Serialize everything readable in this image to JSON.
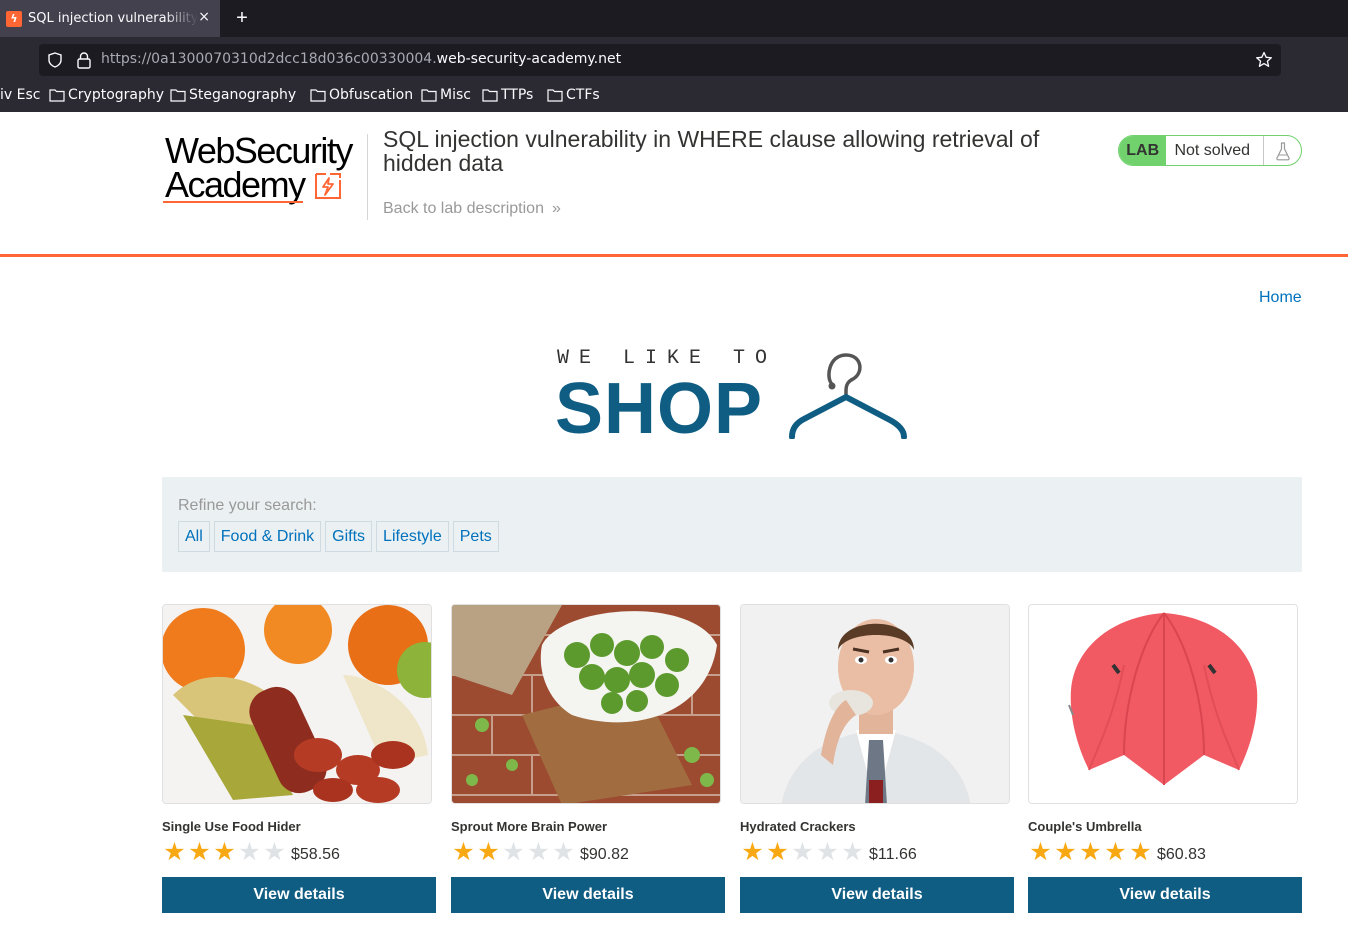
{
  "browser": {
    "tab_title": "SQL injection vulnerability",
    "tab_close": "×",
    "new_tab": "+",
    "url_prefix": "https://0a1300070310d2dcc18d036c00330004.",
    "url_domain": "web-security-academy.net",
    "bookmarks": [
      "iv Esc",
      "Cryptography",
      "Steganography",
      "Obfuscation",
      "Misc",
      "TTPs",
      "CTFs"
    ]
  },
  "lab": {
    "logo_line1": "WebSecurity",
    "logo_line2": "Academy",
    "title": "SQL injection vulnerability in WHERE clause allowing retrieval of hidden data",
    "back_link": "Back to lab description",
    "back_chevrons": "»",
    "status_badge": "LAB",
    "status_text": "Not solved"
  },
  "shop": {
    "home_link": "Home",
    "logo_tagline": "WE LIKE TO",
    "logo_word": "SHOP",
    "refine_label": "Refine your search:",
    "filters": [
      "All",
      "Food & Drink",
      "Gifts",
      "Lifestyle",
      "Pets"
    ],
    "products": [
      {
        "name": "Single Use Food Hider",
        "rating": 3,
        "price": "$58.56",
        "button": "View details"
      },
      {
        "name": "Sprout More Brain Power",
        "rating": 2,
        "price": "$90.82",
        "button": "View details"
      },
      {
        "name": "Hydrated Crackers",
        "rating": 2,
        "price": "$11.66",
        "button": "View details"
      },
      {
        "name": "Couple's Umbrella",
        "rating": 5,
        "price": "$60.83",
        "button": "View details"
      }
    ]
  },
  "colors": {
    "accent": "#ff6633",
    "shop_blue": "#0f5d83",
    "link_blue": "#0071bc",
    "lab_green": "#70d16d",
    "star_on": "#f8a812"
  }
}
